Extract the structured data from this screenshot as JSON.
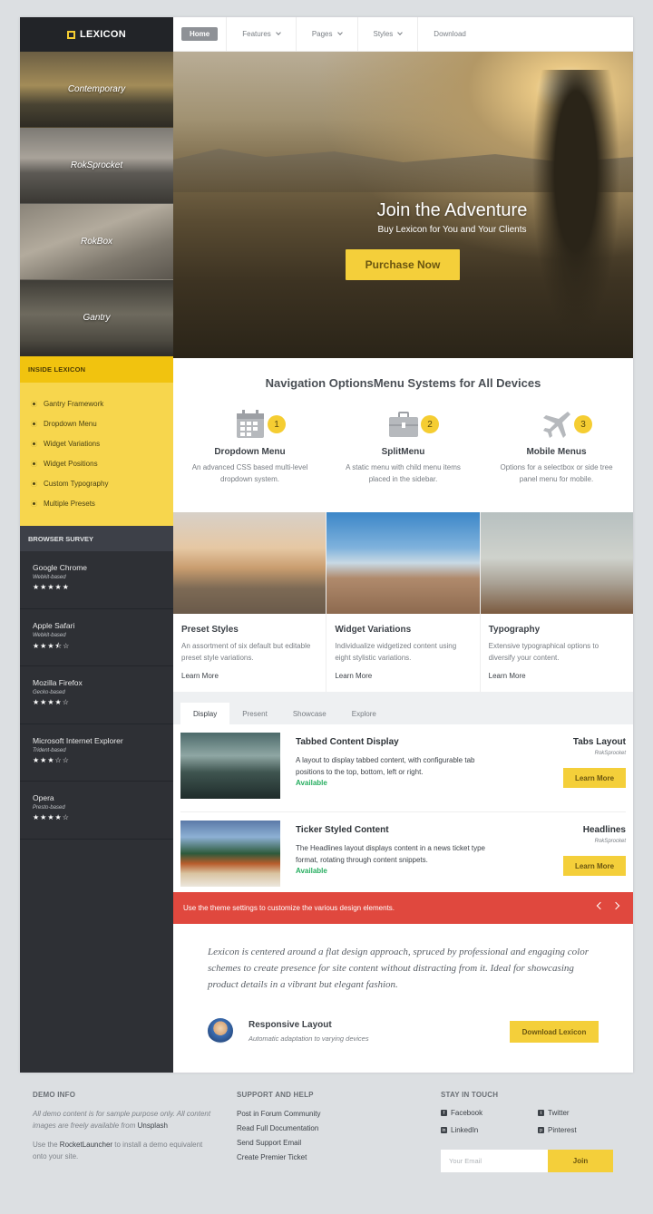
{
  "brand": {
    "name": "LEXICON",
    "accent": "#f5cd32",
    "red": "#e0483e"
  },
  "nav": {
    "items": [
      "Home",
      "Features",
      "Pages",
      "Styles",
      "Download"
    ]
  },
  "sidebar": {
    "thumbs": [
      "Contemporary",
      "RokSprocket",
      "RokBox",
      "Gantry"
    ],
    "inside_title": "INSIDE LEXICON",
    "inside_items": [
      "Gantry Framework",
      "Dropdown Menu",
      "Widget Variations",
      "Widget Positions",
      "Custom Typography",
      "Multiple Presets"
    ],
    "survey_title": "BROWSER SURVEY",
    "survey": [
      {
        "name": "Google Chrome",
        "engine": "Webkit-based",
        "rating": 5
      },
      {
        "name": "Apple Safari",
        "engine": "Webkit-based",
        "rating": 3.5
      },
      {
        "name": "Mozilla Firefox",
        "engine": "Gecko-based",
        "rating": 4
      },
      {
        "name": "Microsoft Internet Explorer",
        "engine": "Trident-based",
        "rating": 3
      },
      {
        "name": "Opera",
        "engine": "Presto-based",
        "rating": 4
      }
    ]
  },
  "hero": {
    "title": "Join the Adventure",
    "subtitle": "Buy Lexicon for You and Your Clients",
    "button": "Purchase Now"
  },
  "navopts": {
    "title": "Navigation OptionsMenu Systems for All Devices",
    "cols": [
      {
        "icon": "calendar-icon",
        "num": "1",
        "title": "Dropdown Menu",
        "text": "An advanced CSS based multi-level dropdown system."
      },
      {
        "icon": "briefcase-icon",
        "num": "2",
        "title": "SplitMenu",
        "text": "A static menu with child menu items placed in the sidebar."
      },
      {
        "icon": "airplane-icon",
        "num": "3",
        "title": "Mobile Menus",
        "text": "Options for a selectbox or side tree panel menu for mobile."
      }
    ]
  },
  "features": [
    {
      "title": "Preset Styles",
      "text": "An assortment of six default but editable preset style variations.",
      "link": "Learn More"
    },
    {
      "title": "Widget Variations",
      "text": "Individualize widgetized content using eight stylistic variations.",
      "link": "Learn More"
    },
    {
      "title": "Typography",
      "text": "Extensive typographical options to diversify your content.",
      "link": "Learn More"
    }
  ],
  "tabs": {
    "labels": [
      "Display",
      "Present",
      "Showcase",
      "Explore"
    ],
    "items": [
      {
        "title": "Tabbed Content Display",
        "text": "A layout to display tabbed content, with configurable tab positions to the top, bottom, left or right.",
        "status": "Available",
        "right_title": "Tabs Layout",
        "right_sub": "RokSprocket",
        "button": "Learn More"
      },
      {
        "title": "Ticker Styled Content",
        "text": "The Headlines layout displays content in a news ticket type format, rotating through content snippets.",
        "status": "Available",
        "right_title": "Headlines",
        "right_sub": "RokSprocket",
        "button": "Learn More"
      }
    ]
  },
  "notice": "Use the theme settings to customize the various design elements.",
  "quote": "Lexicon is centered around a flat design approach, spruced by professional and engaging color schemes to create presence for site content without distracting from it. Ideal for showcasing product details in a vibrant but elegant fashion.",
  "responsive": {
    "title": "Responsive Layout",
    "subtitle": "Automatic adaptation to varying devices",
    "button": "Download Lexicon"
  },
  "footer": {
    "demo_title": "DEMO INFO",
    "demo_p1_a": "All demo content is for sample purpose only. All content images are freely available from ",
    "demo_p1_link": "Unsplash",
    "demo_p2_a": "Use the ",
    "demo_p2_link": "RocketLauncher",
    "demo_p2_b": " to install a demo equivalent onto your site.",
    "support_title": "SUPPORT AND HELP",
    "support_links": [
      "Post in Forum Community",
      "Read Full Documentation",
      "Send Support Email",
      "Create Premier Ticket"
    ],
    "touch_title": "STAY IN TOUCH",
    "social": [
      "Facebook",
      "Twitter",
      "LinkedIn",
      "Pinterest"
    ],
    "email_placeholder": "Your Email",
    "join": "Join"
  }
}
